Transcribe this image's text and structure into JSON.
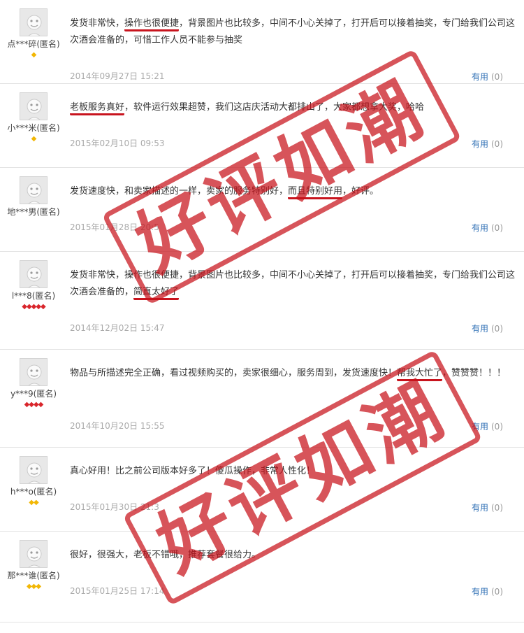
{
  "reviews": [
    {
      "user": "点***碎(匿名)",
      "level_type": "gold",
      "level_count": 1,
      "level_icons": "◆",
      "segments": [
        {
          "text": "发货非常快，"
        },
        {
          "text": "操作也很便捷",
          "hl": true
        },
        {
          "text": "，背景图片也比较多，中间不小心关掉了，打开后可以接着抽奖，专门给我们公司这次酒会准备的，可惜工作人员不能参与抽奖"
        }
      ],
      "date": "2014年09月27日 15:21",
      "useful": "有用",
      "count": "(0)"
    },
    {
      "user": "小***米(匿名)",
      "level_type": "gold",
      "level_count": 1,
      "level_icons": "◆",
      "segments": [
        {
          "text": "老板服务真好",
          "hl": true
        },
        {
          "text": "，软件运行效果超赞，我们这店庆活动大都排山了，大家都想拿大奖，哈哈"
        }
      ],
      "date": "2015年02月10日 09:53",
      "useful": "有用",
      "count": "(0)"
    },
    {
      "user": "地***男(匿名)",
      "level_type": "none",
      "level_count": 0,
      "level_icons": "",
      "segments": [
        {
          "text": "发货速度快，和卖家描述的一样，卖家的服务特别好，"
        },
        {
          "text": "而且特别好用",
          "hl": true
        },
        {
          "text": "，好评。"
        }
      ],
      "date": "2015年01月28日 20:5",
      "useful": "有用",
      "count": "(0)"
    },
    {
      "user": "l***8(匿名)",
      "level_type": "red",
      "level_count": 5,
      "level_icons": "◆◆◆◆◆",
      "segments": [
        {
          "text": "发货非常快，操作也很便捷，背景图片也比较多，中间不小心关掉了，打开后可以接着抽奖，专门给我们公司这次酒会准备的，"
        },
        {
          "text": "简直太好了",
          "hl": true
        }
      ],
      "date": "2014年12月02日 15:47",
      "useful": "有用",
      "count": "(0)"
    },
    {
      "user": "y***9(匿名)",
      "level_type": "red",
      "level_count": 4,
      "level_icons": "◆◆◆◆",
      "segments": [
        {
          "text": "物品与所描述完全正确，看过视频购买的，卖家很细心，服务周到，发货速度快！"
        },
        {
          "text": "帮我大忙了",
          "hl": true
        },
        {
          "text": "，赞赞赞！！！"
        }
      ],
      "date": "2014年10月20日 15:55",
      "useful": "有用",
      "count": "(0)"
    },
    {
      "user": "h***o(匿名)",
      "level_type": "gold",
      "level_count": 2,
      "level_icons": "◆◆",
      "segments": [
        {
          "text": "真心好用！比之前公司版本好多了！傻瓜操作，非常人性化！"
        }
      ],
      "date": "2015年01月30日 21:3",
      "useful": "有用",
      "count": "(0)"
    },
    {
      "user": "那***谁(匿名)",
      "level_type": "gold",
      "level_count": 3,
      "level_icons": "◆◆◆",
      "segments": [
        {
          "text": "很好，很强大，老板不错哦，推荐套餐很给力。"
        }
      ],
      "date": "2015年01月25日 17:14",
      "useful": "有用",
      "count": "(0)"
    }
  ],
  "stamps": [
    "好评如潮",
    "好评如潮"
  ]
}
